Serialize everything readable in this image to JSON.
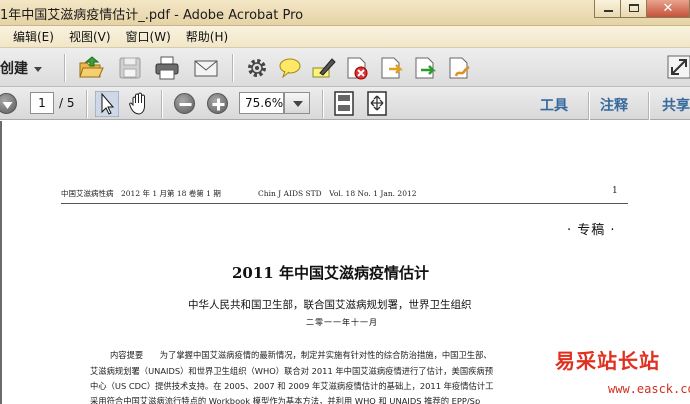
{
  "window": {
    "title": "1年中国艾滋病疫情估计_.pdf - Adobe Acrobat Pro",
    "close_glyph": "✕"
  },
  "menu": [
    "编辑(E)",
    "视图(V)",
    "窗口(W)",
    "帮助(H)"
  ],
  "toolbar": {
    "create_label": "创建",
    "icons": [
      "open-folder-icon",
      "save-icon",
      "print-icon",
      "email-icon",
      "gear-icon",
      "comment-icon",
      "highlight-icon",
      "stamp-icon",
      "attach-icon",
      "export-icon",
      "sign-icon"
    ]
  },
  "nav": {
    "current_page": "1",
    "total_pages": "/ 5",
    "zoom": "75.6%",
    "right_tabs": [
      "工具",
      "注释",
      "共享"
    ]
  },
  "doc": {
    "header_left": "中国艾滋病性病　2012 年 1 月第 18 卷第 1 期",
    "header_mid": "Chin J AIDS STD　Vol. 18 No. 1 Jan. 2012",
    "page_number": "1",
    "column": "· 专稿 ·",
    "title": "2011 年中国艾滋病疫情估计",
    "authors": "中华人民共和国卫生部，联合国艾滋病规划署，世界卫生组织",
    "date": "二零一一年十一月",
    "abstract_lines": [
      "内容提要　　为了掌握中国艾滋病疫情的最新情况，制定并实施有针对性的综合防治措施，中国卫生部、",
      "艾滋病规划署（UNAIDS）和世界卫生组织（WHO）联合对 2011 年中国艾滋病疫情进行了估计，美国疾病预",
      "中心（US CDC）提供技术支持。在 2005、2007 和 2009 年艾滋病疫情估计的基础上，2011 年疫情估计工",
      "采用符合中国艾滋病流行特点的 Workbook 模型作为基本方法，并利用 WHO 和 UNAIDS 推荐的 EPP/Sp"
    ]
  },
  "watermark": {
    "text": "易采站长站",
    "url": "www.easck.com"
  }
}
